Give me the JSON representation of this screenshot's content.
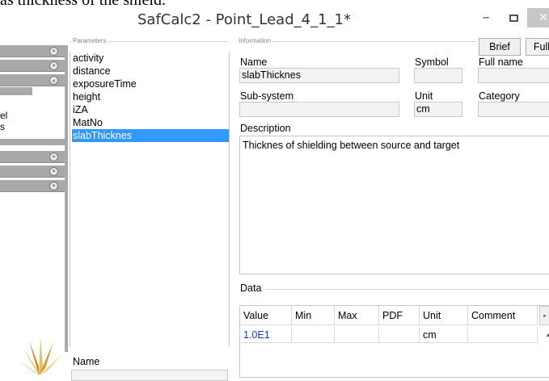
{
  "document": {
    "top_text": "as thickness of the shield."
  },
  "window": {
    "title": "SafCalc2 - Point_Lead_4_1_1*",
    "minimize_glyph": "–",
    "close_glyph": "✕"
  },
  "left_nav": {
    "chevron_glyph": "»",
    "partial_labels": [
      "el",
      "s"
    ]
  },
  "parameters": {
    "group_label": "Parameters",
    "items": [
      "activity",
      "distance",
      "exposureTime",
      "height",
      "iZA",
      "MatNo",
      "slabThicknes"
    ],
    "selected_index": 6,
    "name_label": "Name"
  },
  "information": {
    "group_label": "Information",
    "brief_button": "Brief",
    "full_button": "Full",
    "name_label": "Name",
    "name_value": "slabThicknes",
    "symbol_label": "Symbol",
    "symbol_value": "",
    "full_name_label": "Full name",
    "full_name_value": "",
    "subsystem_label": "Sub-system",
    "subsystem_value": "",
    "unit_label": "Unit",
    "unit_value": "cm",
    "category_label": "Category",
    "category_value": "",
    "description_label": "Description",
    "description_text": "Thicknes of shielding between source and target"
  },
  "data": {
    "group_label": "Data",
    "columns": [
      "Value",
      "Min",
      "Max",
      "PDF",
      "Unit",
      "Comment"
    ],
    "rows": [
      {
        "value": "1.0E1",
        "min": "",
        "max": "",
        "pdf": "",
        "unit": "cm",
        "comment": ""
      }
    ],
    "colors": {
      "value_text": "#1a39c6"
    }
  },
  "colors": {
    "selection": "#3399ff",
    "nav_bar": "#a9a9a9"
  }
}
